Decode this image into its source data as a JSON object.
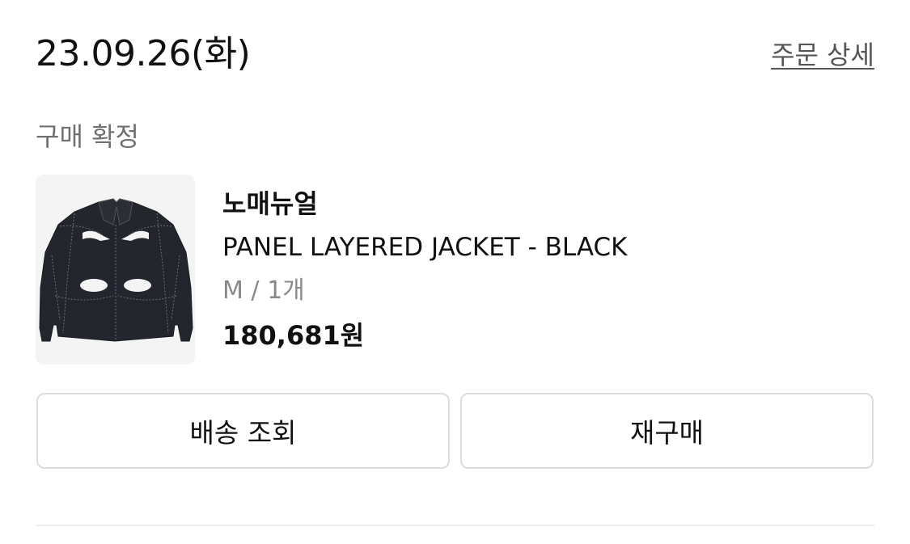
{
  "order": {
    "date": "23.09.26(화)",
    "detail_link": "주문 상세",
    "status": "구매 확정"
  },
  "product": {
    "image_icon": "black-jacket-thumbnail",
    "brand": "노매뉴얼",
    "name": "PANEL LAYERED JACKET - BLACK",
    "option": "M / 1개",
    "price": "180,681원"
  },
  "actions": {
    "delivery_label": "배송 조회",
    "rebuy_label": "재구매"
  },
  "colors": {
    "text_primary": "#111111",
    "text_secondary": "#707070",
    "text_muted": "#8a8a8a",
    "link": "#555555",
    "border": "#dcdcdc",
    "thumb_bg": "#f4f4f4",
    "jacket": "#23262d"
  }
}
